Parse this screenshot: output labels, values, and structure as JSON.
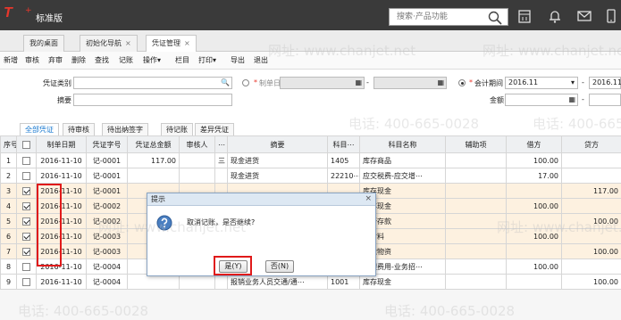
{
  "app": {
    "logo": "T",
    "logo_sup": "+",
    "title": "标准版",
    "title_extra": "◼"
  },
  "search": {
    "placeholder": "搜索·产品功能"
  },
  "tabs": [
    {
      "label": "我的桌面",
      "close": ""
    },
    {
      "label": "初始化导航",
      "close": "×"
    },
    {
      "label": "凭证管理",
      "close": "×"
    }
  ],
  "toolbar": [
    "新增",
    "审核",
    "弃审",
    "删除",
    "查找",
    "记账",
    "操作▾",
    "栏目",
    "打印▾",
    "导出",
    "退出"
  ],
  "form": {
    "voucher_type_label": "凭证类别",
    "summary_label": "摘要",
    "create_date_label": "制单日期",
    "period_label": "会计期间",
    "period_value": "2016.11",
    "period_end": "2016.11",
    "amount_label": "金额",
    "dash": "-",
    "star": "*",
    "cal_glyph": "▦",
    "arrow_glyph": "▾",
    "search_glyph": "🔍"
  },
  "filters": [
    "全部凭证",
    "待审核",
    "待出纳签字",
    "待记账",
    "差异凭证"
  ],
  "table": {
    "headers": [
      "序号",
      "",
      "制单日期",
      "凭证字号",
      "凭证总金额",
      "审核人",
      "⋯",
      "摘要",
      "科目⋯",
      "科目名称",
      "辅助项",
      "借方",
      "贷方"
    ],
    "rows": [
      {
        "no": "1",
        "checked": false,
        "date": "2016-11-10",
        "code": "记-0001",
        "total": "117.00",
        "auditor": "",
        "flag": "三",
        "summary": "现金进货",
        "acct": "1405",
        "acct_name": "库存商品",
        "aux": "",
        "debit": "100.00",
        "credit": "",
        "hl": false
      },
      {
        "no": "2",
        "checked": false,
        "date": "2016-11-10",
        "code": "记-0001",
        "total": "",
        "auditor": "",
        "flag": "",
        "summary": "现金进货",
        "acct": "22210⋯",
        "acct_name": "应交税费-应交增⋯",
        "aux": "",
        "debit": "17.00",
        "credit": "",
        "hl": false
      },
      {
        "no": "3",
        "checked": true,
        "date": "2016-11-10",
        "code": "记-0001",
        "total": "",
        "auditor": "",
        "flag": "",
        "summary": "",
        "acct": "",
        "acct_name": "库存现金",
        "aux": "",
        "debit": "",
        "credit": "117.00",
        "hl": true
      },
      {
        "no": "4",
        "checked": true,
        "date": "2016-11-10",
        "code": "记-0002",
        "total": "",
        "auditor": "",
        "flag": "",
        "summary": "",
        "acct": "",
        "acct_name": "库存现金",
        "aux": "",
        "debit": "100.00",
        "credit": "",
        "hl": true
      },
      {
        "no": "5",
        "checked": true,
        "date": "2016-11-10",
        "code": "记-0002",
        "total": "",
        "auditor": "",
        "flag": "",
        "summary": "",
        "acct": "",
        "acct_name": "银行存款",
        "aux": "",
        "debit": "",
        "credit": "100.00",
        "hl": true
      },
      {
        "no": "6",
        "checked": true,
        "date": "2016-11-10",
        "code": "记-0003",
        "total": "",
        "auditor": "",
        "flag": "",
        "summary": "",
        "acct": "",
        "acct_name": "原材料",
        "aux": "",
        "debit": "100.00",
        "credit": "",
        "hl": true
      },
      {
        "no": "7",
        "checked": true,
        "date": "2016-11-10",
        "code": "记-0003",
        "total": "",
        "auditor": "",
        "flag": "",
        "summary": "",
        "acct": "",
        "acct_name": "在途物资",
        "aux": "",
        "debit": "",
        "credit": "100.00",
        "hl": true
      },
      {
        "no": "8",
        "checked": false,
        "date": "2016-11-10",
        "code": "记-0004",
        "total": "",
        "auditor": "",
        "flag": "",
        "summary": "",
        "acct": "",
        "acct_name": "管理费用-业务招⋯",
        "aux": "",
        "debit": "100.00",
        "credit": "",
        "hl": false
      },
      {
        "no": "9",
        "checked": false,
        "date": "2016-11-10",
        "code": "记-0004",
        "total": "",
        "auditor": "",
        "flag": "",
        "summary": "报销业务人员交通/通⋯",
        "acct": "1001",
        "acct_name": "库存现金",
        "aux": "",
        "debit": "",
        "credit": "100.00",
        "hl": false
      }
    ]
  },
  "dialog": {
    "title": "提示",
    "close": "×",
    "message": "取消记账，是否继续?",
    "yes": "是(Y)",
    "no": "否(N)"
  },
  "watermark": {
    "site": "网址: www.chanjet.net",
    "phone": "电话: 400-665-0028"
  }
}
